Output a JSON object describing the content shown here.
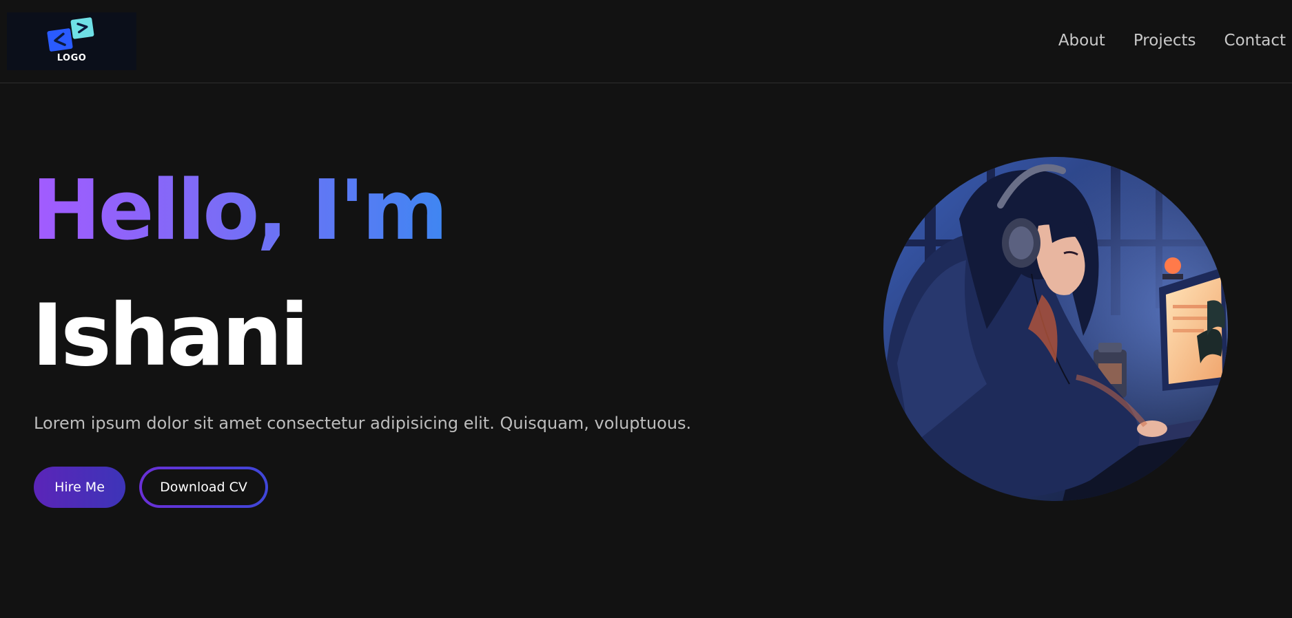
{
  "header": {
    "logo_text": "LOGO",
    "nav": [
      {
        "label": "About"
      },
      {
        "label": "Projects"
      },
      {
        "label": "Contact"
      }
    ]
  },
  "hero": {
    "greeting": "Hello, I'm",
    "name": "Ishani",
    "tagline": "Lorem ipsum dolor sit amet consectetur adipisicing elit. Quisquam, voluptuous.",
    "buttons": {
      "hire": "Hire Me",
      "cv": "Download CV"
    },
    "avatar_icon": "anime-girl-at-computer-illustration"
  },
  "colors": {
    "background": "#121212",
    "gradient_start": "#a35bff",
    "gradient_end": "#3f86f2",
    "button_purple": "#5b25b8",
    "button_blue": "#3d34b8",
    "nav_text": "#c9c9c9",
    "tagline_text": "#bdbdbd"
  }
}
